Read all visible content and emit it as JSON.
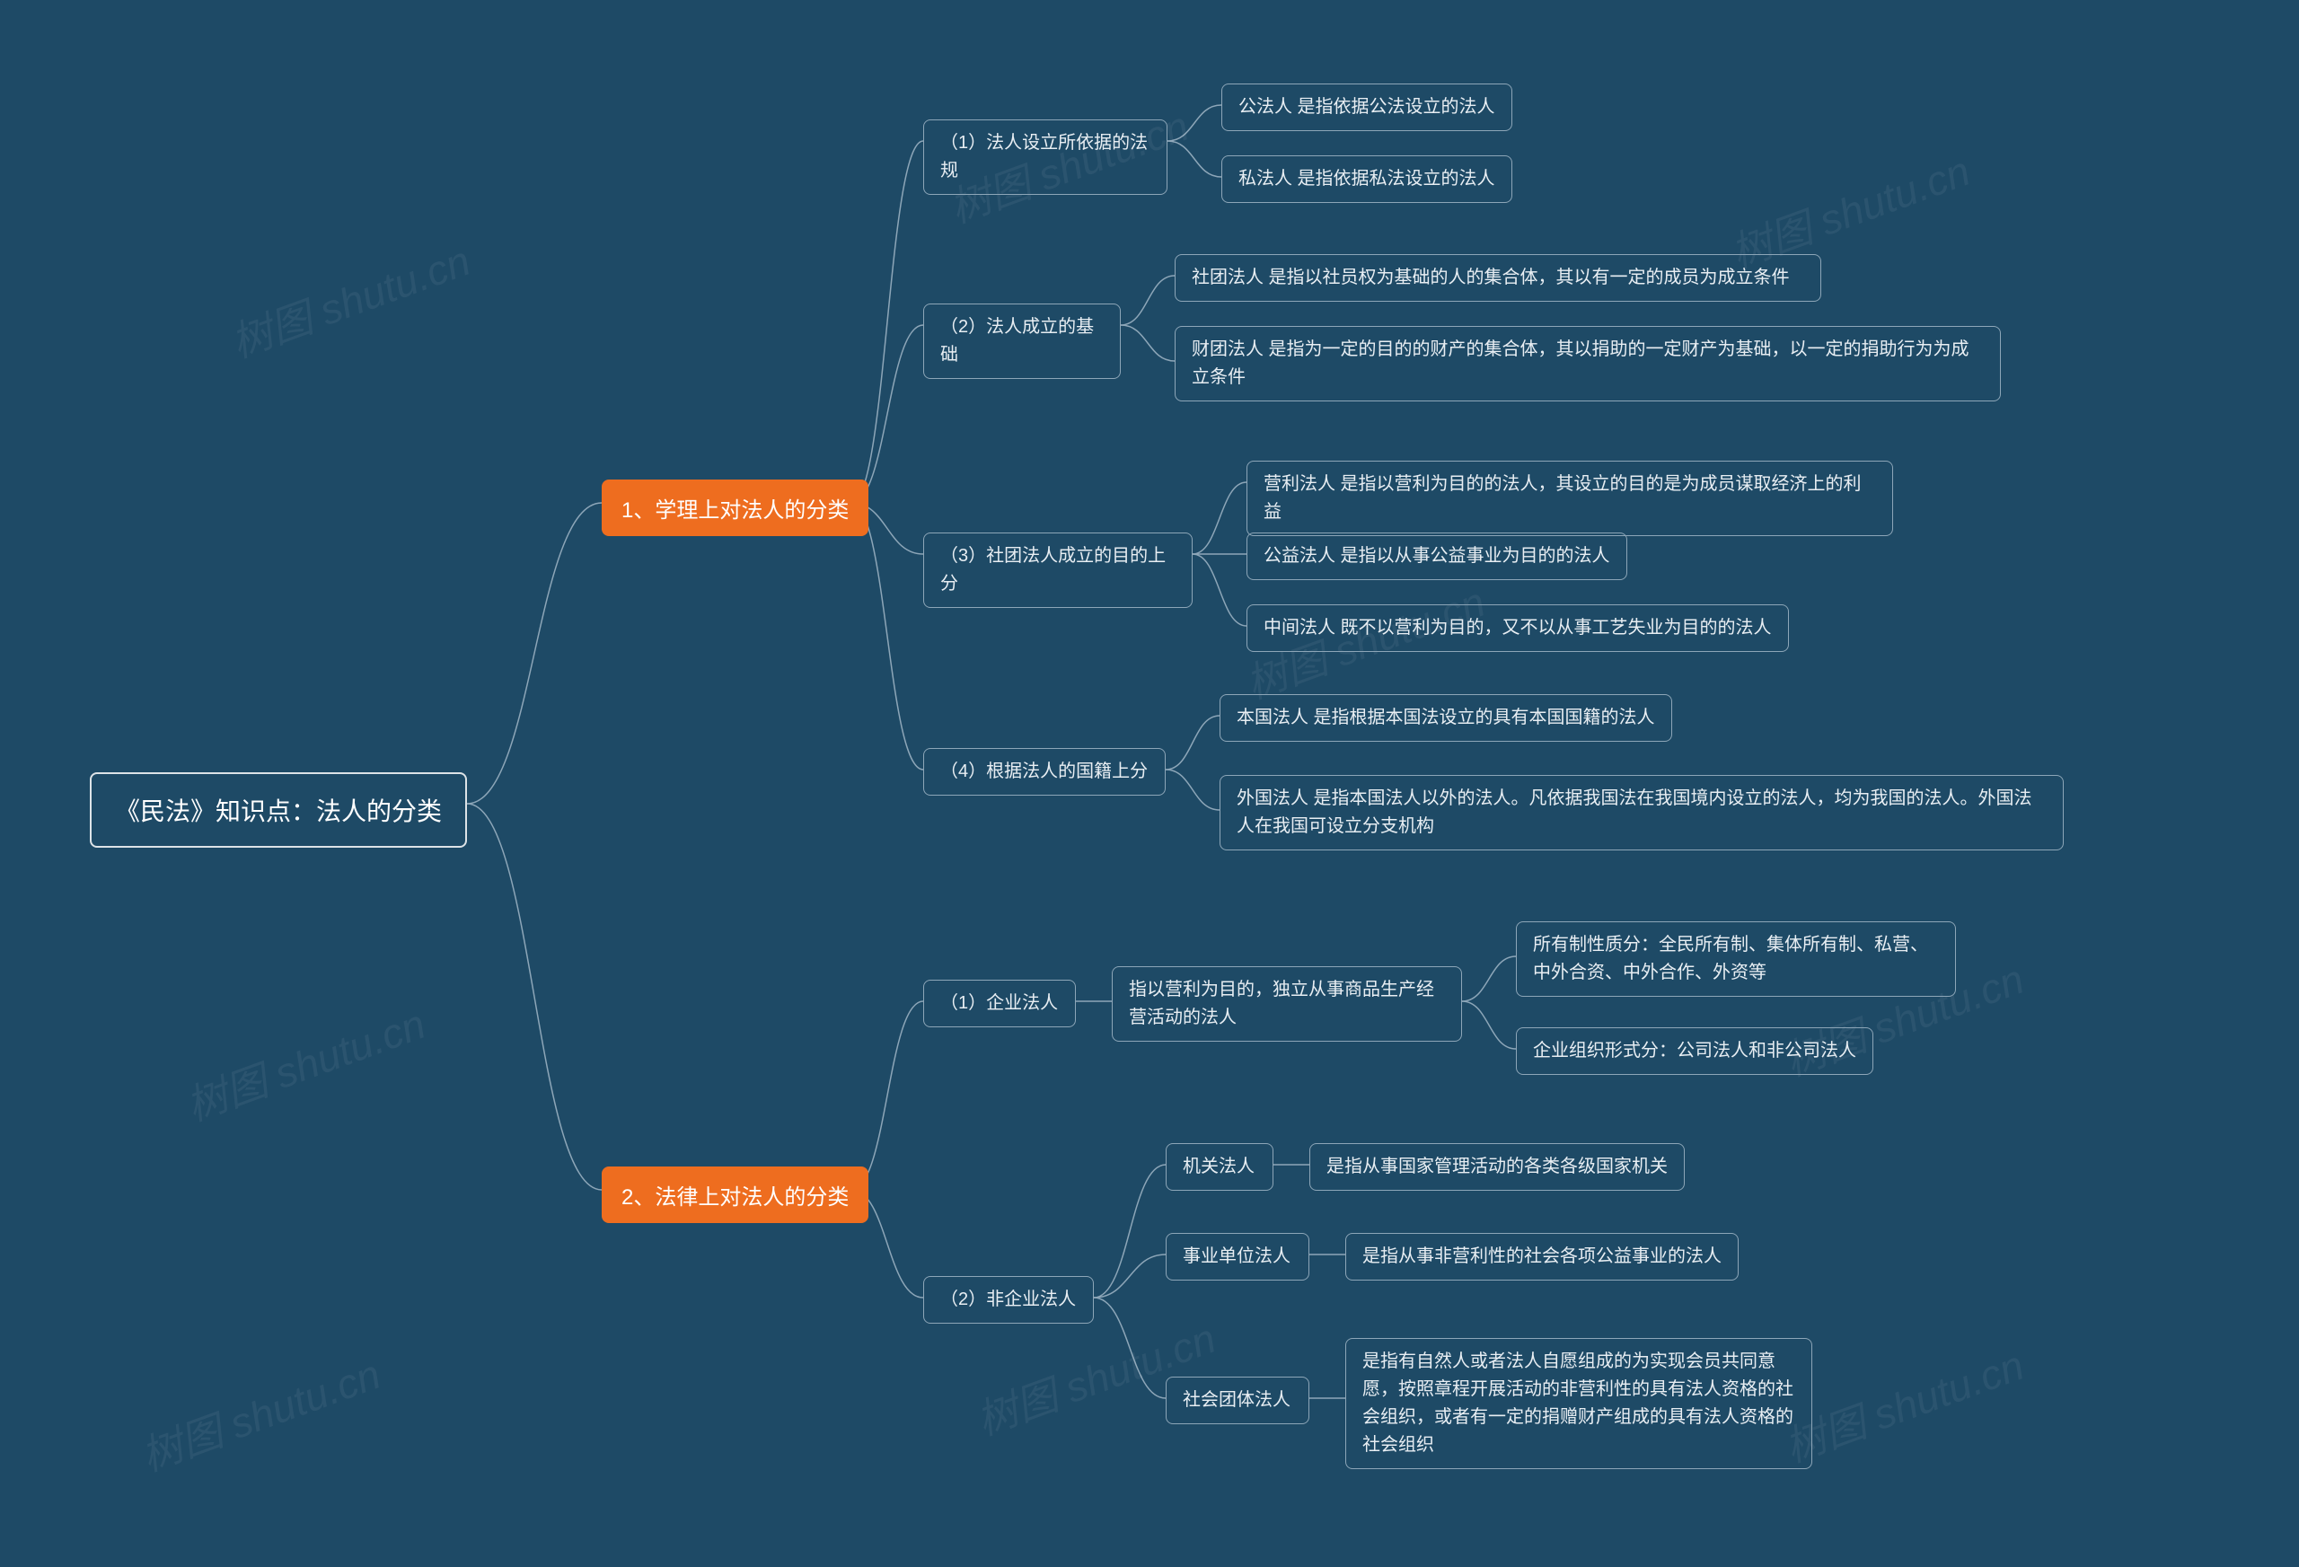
{
  "watermark": "树图 shutu.cn",
  "root": "《民法》知识点：法人的分类",
  "cat1": "1、学理上对法人的分类",
  "cat2": "2、法律上对法人的分类",
  "b1": {
    "title": "（1）法人设立所依据的法规",
    "c1": "公法人 是指依据公法设立的法人",
    "c2": "私法人 是指依据私法设立的法人"
  },
  "b2": {
    "title": "（2）法人成立的基础",
    "c1": "社团法人 是指以社员权为基础的人的集合体，其以有一定的成员为成立条件",
    "c2": "财团法人 是指为一定的目的的财产的集合体，其以捐助的一定财产为基础，以一定的捐助行为为成立条件"
  },
  "b3": {
    "title": "（3）社团法人成立的目的上分",
    "c1": "营利法人 是指以营利为目的的法人，其设立的目的是为成员谋取经济上的利益",
    "c2": "公益法人 是指以从事公益事业为目的的法人",
    "c3": "中间法人 既不以营利为目的，又不以从事工艺失业为目的的法人"
  },
  "b4": {
    "title": "（4）根据法人的国籍上分",
    "c1": "本国法人 是指根据本国法设立的具有本国国籍的法人",
    "c2": "外国法人 是指本国法人以外的法人。凡依据我国法在我国境内设立的法人，均为我国的法人。外国法人在我国可设立分支机构"
  },
  "b5": {
    "title": "（1）企业法人",
    "desc": "指以营利为目的，独立从事商品生产经营活动的法人",
    "c1": "所有制性质分：全民所有制、集体所有制、私营、中外合资、中外合作、外资等",
    "c2": "企业组织形式分：公司法人和非公司法人"
  },
  "b6": {
    "title": "（2）非企业法人",
    "c1": {
      "name": "机关法人",
      "desc": "是指从事国家管理活动的各类各级国家机关"
    },
    "c2": {
      "name": "事业单位法人",
      "desc": "是指从事非营利性的社会各项公益事业的法人"
    },
    "c3": {
      "name": "社会团体法人",
      "desc": "是指有自然人或者法人自愿组成的为实现会员共同意愿，按照章程开展活动的非营利性的具有法人资格的社会组织，或者有一定的捐赠财产组成的具有法人资格的社会组织"
    }
  }
}
